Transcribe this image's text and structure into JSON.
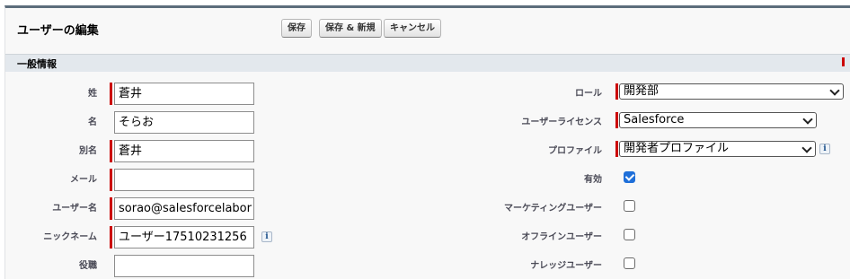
{
  "header": {
    "title": "ユーザーの編集",
    "buttons": {
      "save": "保存",
      "save_new": "保存 & 新規",
      "cancel": "キャンセル"
    }
  },
  "section": {
    "title": "一般情報"
  },
  "left_fields": {
    "last_name": {
      "label": "姓",
      "value": "蒼井",
      "required": true
    },
    "first_name": {
      "label": "名",
      "value": "そらお",
      "required": false
    },
    "alias": {
      "label": "別名",
      "value": "蒼井",
      "required": true
    },
    "email": {
      "label": "メール",
      "value": "",
      "required": true
    },
    "username": {
      "label": "ユーザー名",
      "value": "sorao@salesforcelabor",
      "required": true
    },
    "nickname": {
      "label": "ニックネーム",
      "value": "ユーザー17510231256",
      "required": true
    },
    "title": {
      "label": "役職",
      "value": "",
      "required": false
    }
  },
  "right_fields": {
    "role": {
      "label": "ロール",
      "value": "開発部",
      "required": true
    },
    "license": {
      "label": "ユーザーライセンス",
      "value": "Salesforce",
      "required": true
    },
    "profile": {
      "label": "プロファイル",
      "value": "開発者プロファイル",
      "required": true
    },
    "active": {
      "label": "有効",
      "checked": true
    },
    "marketing": {
      "label": "マーケティングユーザー",
      "checked": false
    },
    "offline": {
      "label": "オフラインユーザー",
      "checked": false
    },
    "knowledge": {
      "label": "ナレッジユーザー",
      "checked": false
    }
  },
  "icons": {
    "info": "info-icon",
    "checkmark": "checkmark-icon"
  },
  "info_glyph": "i",
  "colors": {
    "required": "#cc0000",
    "section_bg": "#e3e8ed",
    "header_border": "#5c6d7b",
    "checkbox_on": "#1e6fd9"
  }
}
